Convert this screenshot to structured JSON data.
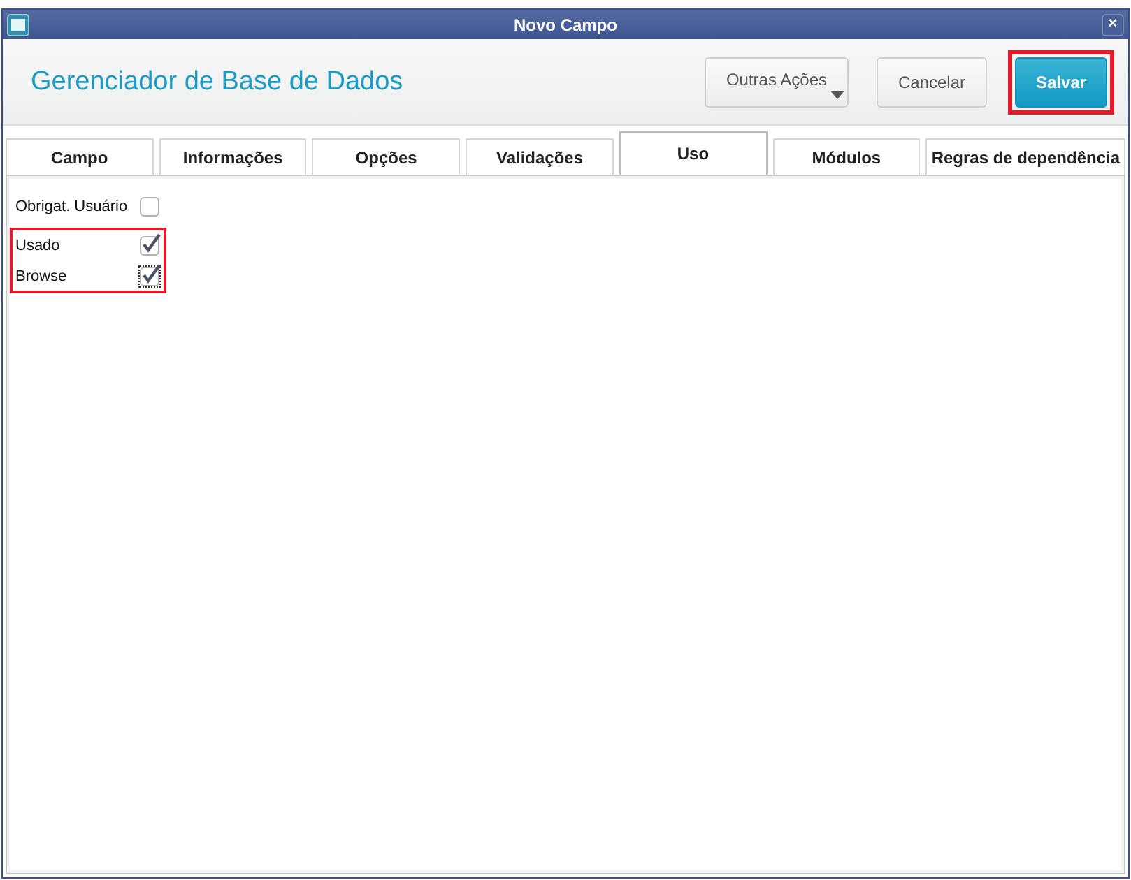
{
  "window": {
    "title": "Novo Campo",
    "close": "×"
  },
  "header": {
    "title": "Gerenciador de Base de Dados",
    "buttons": [
      {
        "label": "Outras Ações",
        "kind": "menu",
        "highlighted": false
      },
      {
        "label": "Cancelar",
        "kind": "plain",
        "highlighted": false
      },
      {
        "label": "Salvar",
        "kind": "primary",
        "highlighted": true
      }
    ]
  },
  "tabs": [
    {
      "label": "Campo",
      "selected": false
    },
    {
      "label": "Informações",
      "selected": false
    },
    {
      "label": "Opções",
      "selected": false
    },
    {
      "label": "Validações",
      "selected": false
    },
    {
      "label": "Uso",
      "selected": true
    },
    {
      "label": "Módulos",
      "selected": false
    },
    {
      "label": "Regras de dependência",
      "selected": false
    }
  ],
  "groups": [
    {
      "highlighted": false,
      "fields": [
        {
          "label": "Obrigat. Usuário",
          "checked": false,
          "focused": false
        }
      ]
    },
    {
      "highlighted": true,
      "fields": [
        {
          "label": "Usado",
          "checked": true,
          "focused": false
        },
        {
          "label": "Browse",
          "checked": true,
          "focused": true
        }
      ]
    }
  ]
}
